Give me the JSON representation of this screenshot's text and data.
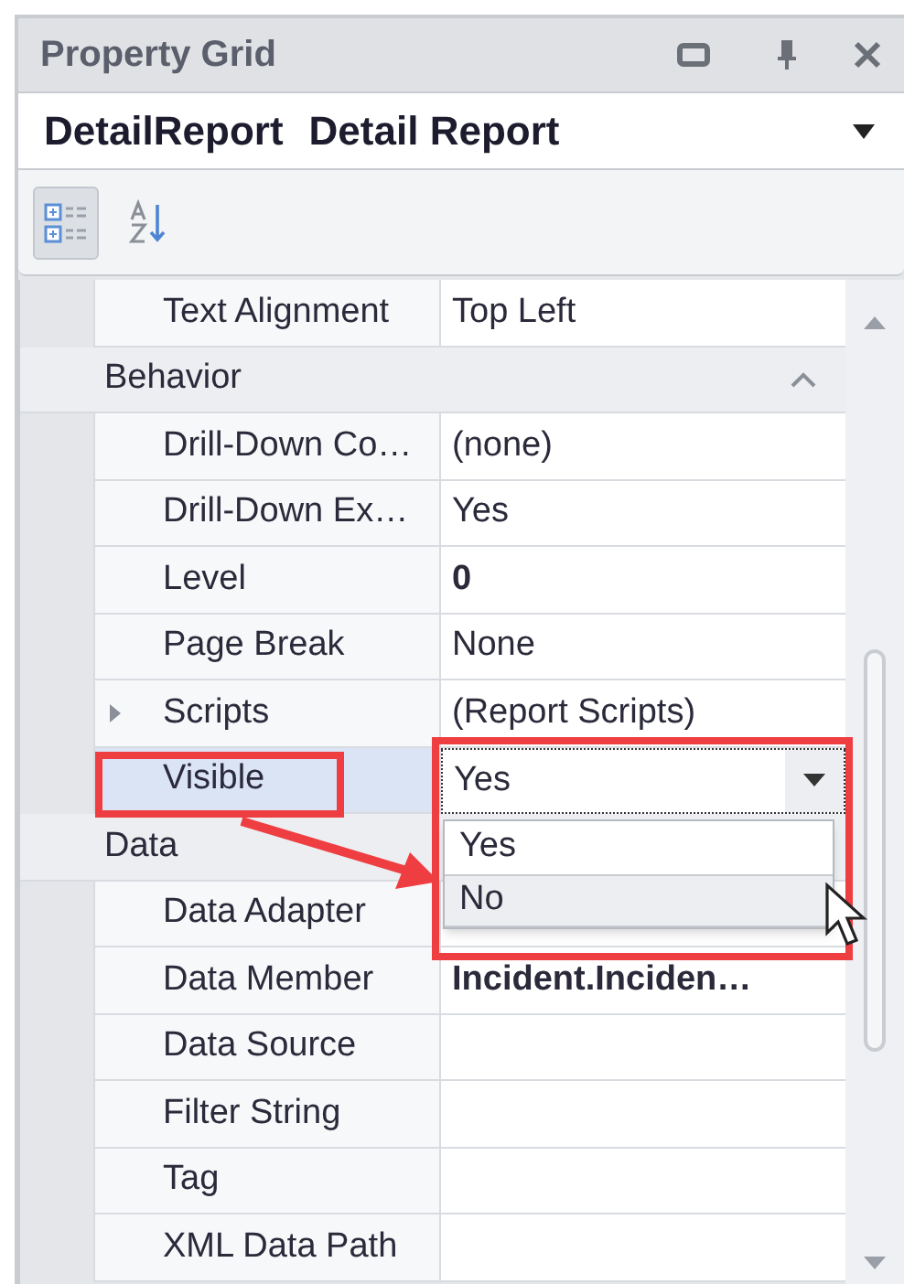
{
  "window": {
    "title": "Property Grid"
  },
  "selector": {
    "name": "DetailReport",
    "type": "Detail Report"
  },
  "toolbar": [
    {
      "kind": "categorized",
      "selected": true
    },
    {
      "kind": "alphabetical",
      "selected": false
    }
  ],
  "rows": [
    {
      "kind": "property",
      "label": "Text Alignment",
      "value": "Top Left",
      "bold": false,
      "expandable": false,
      "selected": false
    },
    {
      "kind": "category",
      "label": "Behavior",
      "expanded": true
    },
    {
      "kind": "property",
      "label": "Drill-Down Co…",
      "value": "(none)",
      "bold": false,
      "expandable": false,
      "selected": false
    },
    {
      "kind": "property",
      "label": "Drill-Down Ex…",
      "value": "Yes",
      "bold": false,
      "expandable": false,
      "selected": false
    },
    {
      "kind": "property",
      "label": "Level",
      "value": "0",
      "bold": true,
      "expandable": false,
      "selected": false
    },
    {
      "kind": "property",
      "label": "Page Break",
      "value": "None",
      "bold": false,
      "expandable": false,
      "selected": false
    },
    {
      "kind": "property",
      "label": "Scripts",
      "value": "(Report Scripts)",
      "bold": false,
      "expandable": true,
      "selected": false
    },
    {
      "kind": "property",
      "label": "Visible",
      "value": "Yes",
      "bold": false,
      "expandable": false,
      "selected": true
    },
    {
      "kind": "category",
      "label": "Data"
    },
    {
      "kind": "property",
      "label": "Data Adapter",
      "expandable": false,
      "selected": false
    },
    {
      "kind": "property",
      "label": "Data Member",
      "value": "Incident.Inciden…",
      "bold": true,
      "expandable": false,
      "selected": false
    },
    {
      "kind": "property",
      "label": "Data Source",
      "expandable": false,
      "selected": false
    },
    {
      "kind": "property",
      "label": "Filter String",
      "expandable": false,
      "selected": false
    },
    {
      "kind": "property",
      "label": "Tag",
      "expandable": false,
      "selected": false
    },
    {
      "kind": "property",
      "label": "XML Data Path",
      "expandable": false,
      "selected": false
    }
  ],
  "dropdown": {
    "options": [
      {
        "label": "Yes",
        "hovered": false
      },
      {
        "label": "No",
        "hovered": true
      }
    ]
  }
}
